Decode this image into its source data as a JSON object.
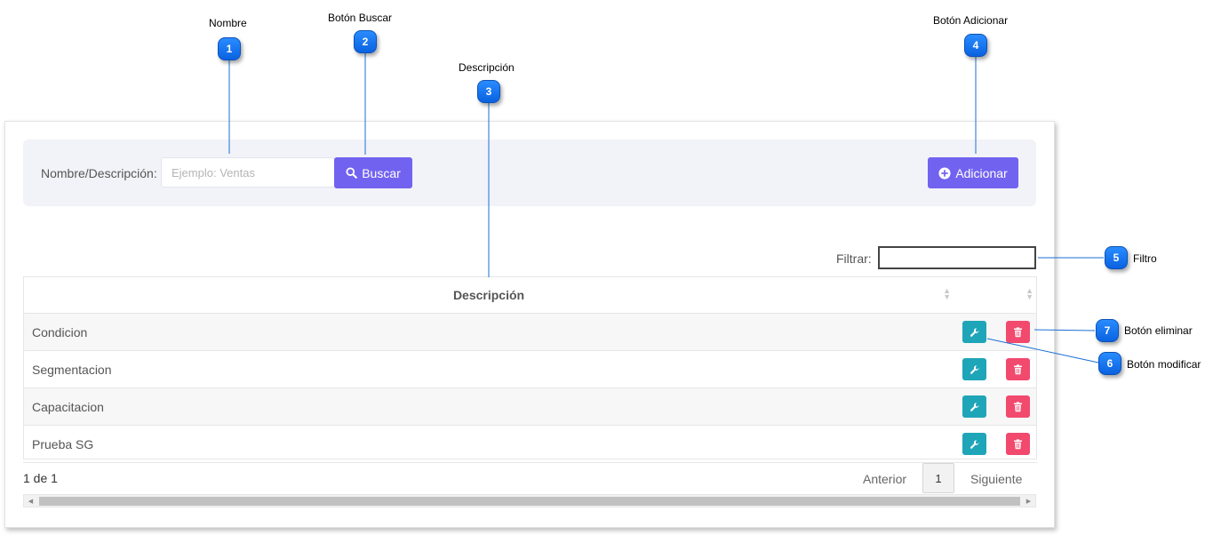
{
  "callouts": [
    {
      "num": "1",
      "label": "Nombre"
    },
    {
      "num": "2",
      "label": "Botón  Buscar"
    },
    {
      "num": "3",
      "label": "Descripción"
    },
    {
      "num": "4",
      "label": "Botón  Adicionar"
    },
    {
      "num": "5",
      "label": "Filtro"
    },
    {
      "num": "6",
      "label": "Botón modificar"
    },
    {
      "num": "7",
      "label": "Botón eliminar"
    }
  ],
  "search": {
    "label": "Nombre/Descripción:",
    "placeholder": "Ejemplo: Ventas",
    "value": "",
    "search_button": "Buscar",
    "add_button": "Adicionar"
  },
  "filter": {
    "label": "Filtrar:",
    "value": ""
  },
  "table": {
    "header": "Descripción",
    "rows": [
      {
        "description": "Condicion"
      },
      {
        "description": "Segmentacion"
      },
      {
        "description": "Capacitacion"
      },
      {
        "description": "Prueba SG"
      }
    ]
  },
  "pagination": {
    "info": "1 de 1",
    "prev": "Anterior",
    "current": "1",
    "next": "Siguiente"
  },
  "icons": {
    "search": "search-icon",
    "add": "plus-circle-icon",
    "edit": "wrench-icon",
    "delete": "trash-icon"
  },
  "colors": {
    "accent": "#7262f0",
    "edit": "#1fa5b8",
    "delete": "#f2496e",
    "badge": "#1a7cf5"
  }
}
